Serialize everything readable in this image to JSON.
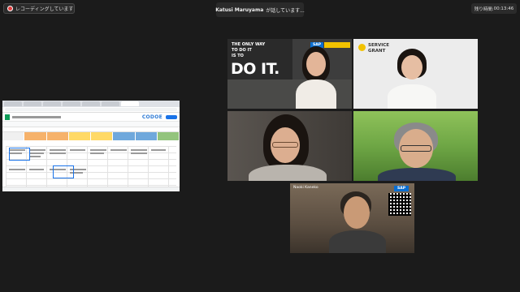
{
  "recording": {
    "label": "レコーディングしています..."
  },
  "speaking": {
    "name": "Katusi Maruyama",
    "suffix": "が話しています..."
  },
  "timer": {
    "label": "残り時間:",
    "value": "00:13:46"
  },
  "share": {
    "brand": "CODOE"
  },
  "tiles": [
    {
      "id": "do-it",
      "poster_small": [
        "THE ONLY WAY",
        "TO DO IT",
        "IS TO"
      ],
      "poster_big": "DO IT.",
      "badge": "SAP"
    },
    {
      "id": "service-grant",
      "logo_lines": [
        "SERVICE",
        "GRANT"
      ]
    },
    {
      "id": "laughing-woman"
    },
    {
      "id": "man-glasses"
    },
    {
      "id": "naoki",
      "name": "Naoki Kaneko",
      "badge": "SAP"
    }
  ],
  "colors": {
    "background": "#1b1b1b",
    "accent_yellow": "#f2c200",
    "sap_blue": "#0a6ed1"
  }
}
